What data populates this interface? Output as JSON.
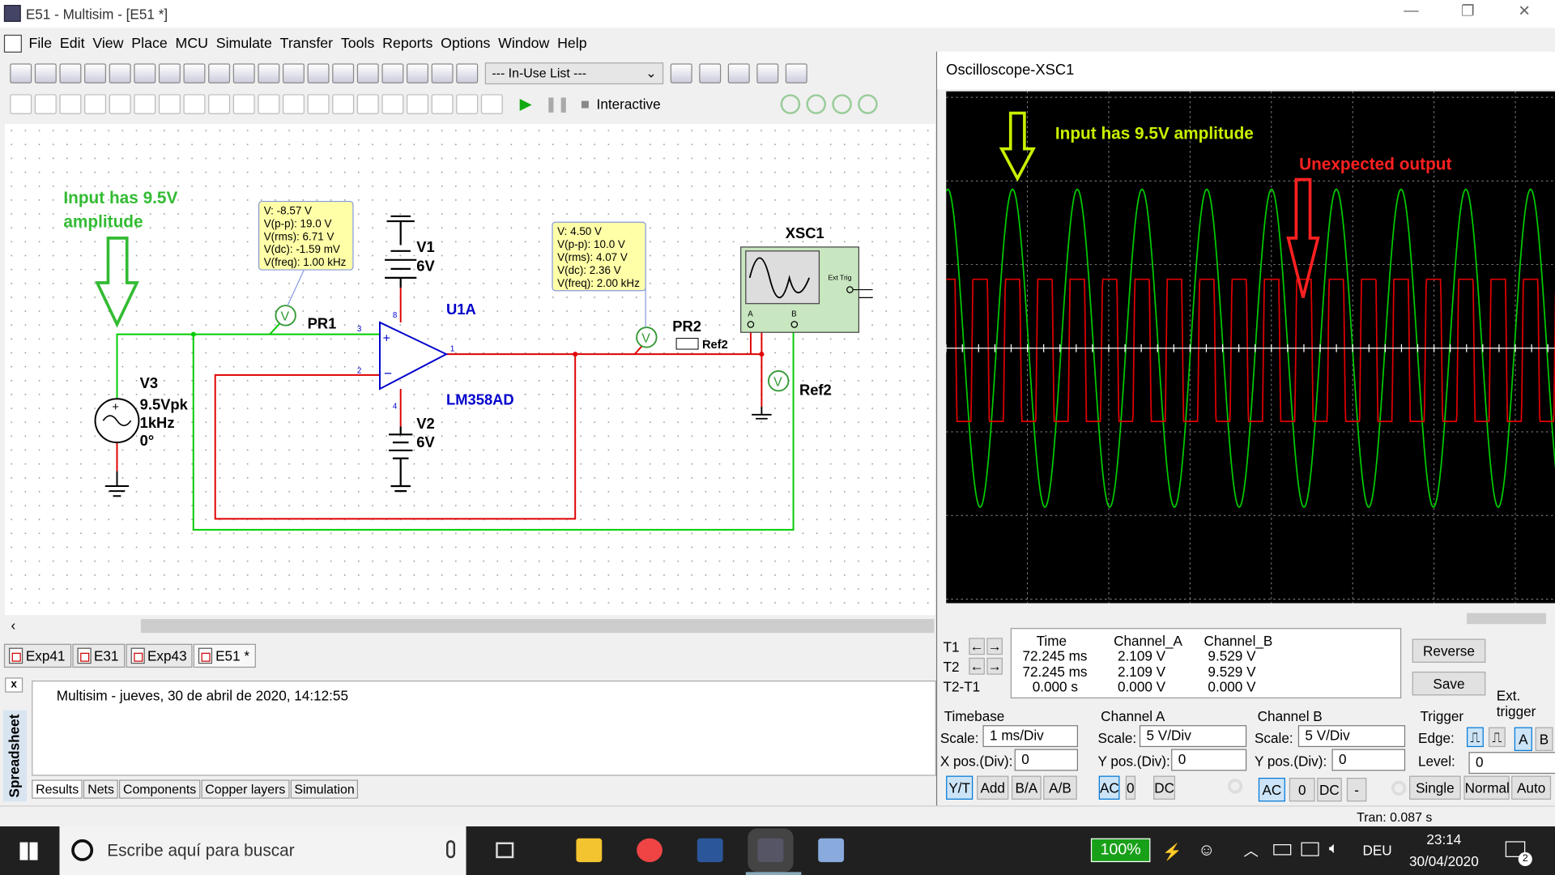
{
  "window": {
    "title": "E51 - Multisim - [E51 *]",
    "min": "—",
    "restore": "❐",
    "close": "✕"
  },
  "menu": [
    "File",
    "Edit",
    "View",
    "Place",
    "MCU",
    "Simulate",
    "Transfer",
    "Tools",
    "Reports",
    "Options",
    "Window",
    "Help"
  ],
  "toolbar1": {
    "icons": [
      "new-icon",
      "open-icon",
      "open-sample-icon",
      "save-icon",
      "print-icon",
      "print-preview-icon",
      "cut-icon",
      "copy-icon",
      "paste-icon",
      "undo-icon",
      "redo-icon",
      "toggle-design-toolbox-icon",
      "spreadsheet-icon",
      "sim-icon",
      "grapher-icon",
      "postprocessor-icon",
      "database-icon",
      "component-wizard-icon",
      "in-use-icon"
    ],
    "in_use_list": "--- In-Use List ---",
    "icons2": [
      "erc-icon",
      "back-annotate-icon",
      "forward-annotate-icon",
      "transfer-icon",
      "zoom-icon"
    ]
  },
  "toolbar2": {
    "icons": [
      "source-icon",
      "basic-icon",
      "diode-icon",
      "transistor-icon",
      "analog-icon",
      "ttl-icon",
      "cmos-icon",
      "mcu-icon",
      "mixed-icon",
      "indicator-icon",
      "power-icon",
      "misc-icon",
      "advanced-periph-icon",
      "rf-icon",
      "electromech-icon",
      "ni-icon",
      "connector-icon",
      "mcu-module-icon",
      "hierarchical-icon",
      "bus-icon"
    ],
    "run": "run-icon",
    "pause": "pause-icon",
    "stop": "stop-icon",
    "interactive": "Interactive",
    "probes": [
      "voltage-probe-icon",
      "current-probe-icon",
      "power-probe-icon",
      "diff-probe-icon"
    ]
  },
  "schematic": {
    "note_left": [
      "Input has 9.5V",
      "amplitude"
    ],
    "probe1": {
      "name": "PR1",
      "readout": [
        "V: -8.57 V",
        "V(p-p): 19.0 V",
        "V(rms): 6.71 V",
        "V(dc): -1.59 mV",
        "V(freq): 1.00 kHz"
      ]
    },
    "probe2": {
      "name": "PR2",
      "ref": "Ref2",
      "readout": [
        "V: 4.50 V",
        "V(p-p): 10.0 V",
        "V(rms): 4.07 V",
        "V(dc): 2.36 V",
        "V(freq): 2.00 kHz"
      ]
    },
    "probe3": {
      "ref": "Ref2"
    },
    "probe_glyph": "V",
    "v1": {
      "name": "V1",
      "value": "6V"
    },
    "v2": {
      "name": "V2",
      "value": "6V"
    },
    "v3": {
      "name": "V3",
      "lines": [
        "9.5Vpk",
        "1kHz",
        "0°"
      ]
    },
    "opamp": {
      "name": "U1A",
      "part": "LM358AD",
      "pins": [
        "3",
        "2",
        "1",
        "8",
        "4"
      ]
    },
    "scope": {
      "name": "XSC1",
      "ext": "Ext Trig",
      "a": "A",
      "b": "B"
    },
    "colors": {
      "green": "#00cc00",
      "red": "#e00000",
      "label": "#0000cc",
      "note": "#33bb33",
      "tooltip": "#ffffa8"
    }
  },
  "doc_tabs": [
    "Exp41",
    "E31",
    "Exp43",
    "E51 *"
  ],
  "spreadsheet": {
    "title": "Spreadsheet",
    "close": "x",
    "log": "Multisim  -  jueves, 30 de abril de 2020, 14:12:55",
    "tabs": [
      "Results",
      "Nets",
      "Components",
      "Copper layers",
      "Simulation"
    ]
  },
  "status": {
    "tran": "Tran: 0.087 s"
  },
  "oscilloscope": {
    "title": "Oscilloscope-XSC1",
    "annotations": {
      "input": "Input has 9.5V amplitude",
      "output": "Unexpected output",
      "input_color": "#c8f000",
      "output_color": "#ff2020"
    },
    "traces": {
      "channel_a": {
        "color": "#e00000",
        "freq_khz": 2.0,
        "max_v": 4.5,
        "min_v": -5.5
      },
      "channel_b": {
        "color": "#00cc00",
        "freq_khz": 1.0,
        "amplitude_v": 9.5
      }
    },
    "cursor_labels": [
      "T1",
      "T2",
      "T2-T1"
    ],
    "table": {
      "headers": [
        "Time",
        "Channel_A",
        "Channel_B"
      ],
      "rows": [
        [
          "72.245 ms",
          "2.109 V",
          "9.529 V"
        ],
        [
          "72.245 ms",
          "2.109 V",
          "9.529 V"
        ],
        [
          "0.000 s",
          "0.000 V",
          "0.000 V"
        ]
      ]
    },
    "reverse": "Reverse",
    "save": "Save",
    "ext_trigger": "Ext. trigger",
    "timebase": {
      "title": "Timebase",
      "scale_label": "Scale:",
      "scale": "1 ms/Div",
      "xpos_label": "X pos.(Div):",
      "xpos": "0",
      "modes": [
        "Y/T",
        "Add",
        "B/A",
        "A/B"
      ]
    },
    "channel_a": {
      "title": "Channel A",
      "scale_label": "Scale:",
      "scale": "5  V/Div",
      "ypos_label": "Y pos.(Div):",
      "ypos": "0",
      "coupling": [
        "AC",
        "0",
        "DC"
      ]
    },
    "channel_b": {
      "title": "Channel B",
      "scale_label": "Scale:",
      "scale": "5  V/Div",
      "ypos_label": "Y pos.(Div):",
      "ypos": "0",
      "coupling": [
        "AC",
        "0",
        "DC",
        "-"
      ]
    },
    "trigger": {
      "title": "Trigger",
      "edge_label": "Edge:",
      "level_label": "Level:",
      "level": "0",
      "src": [
        "A",
        "B"
      ],
      "modes": [
        "Single",
        "Normal",
        "Auto"
      ]
    }
  },
  "taskbar": {
    "search": "Escribe aquí para buscar",
    "battery": "100%",
    "lang": "DEU",
    "time": "23:14",
    "date": "30/04/2020",
    "notif": "2",
    "apps": [
      "file-explorer-icon",
      "chrome-icon",
      "word-icon",
      "multisim-icon",
      "paint-icon"
    ]
  }
}
